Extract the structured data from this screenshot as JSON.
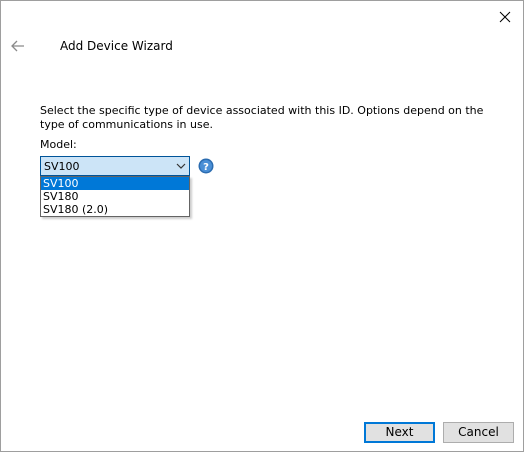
{
  "window": {
    "title": "Add Device Wizard"
  },
  "main": {
    "instructions": "Select the specific type of device associated with this ID. Options depend on the type of communications in use.",
    "model_label": "Model:",
    "model_select": {
      "value": "SV100",
      "options": [
        "SV100",
        "SV180",
        "SV180 (2.0)"
      ],
      "highlighted_index": 0
    }
  },
  "footer": {
    "next_label": "Next",
    "cancel_label": "Cancel"
  },
  "icons": {
    "close": "close-icon",
    "back": "back-arrow-icon",
    "dropdown": "chevron-down-icon",
    "help": "help-icon"
  },
  "colors": {
    "select_bg": "#cce4f7",
    "select_border": "#005499",
    "highlight": "#0078d7",
    "help_icon": "#2b6cb0"
  }
}
